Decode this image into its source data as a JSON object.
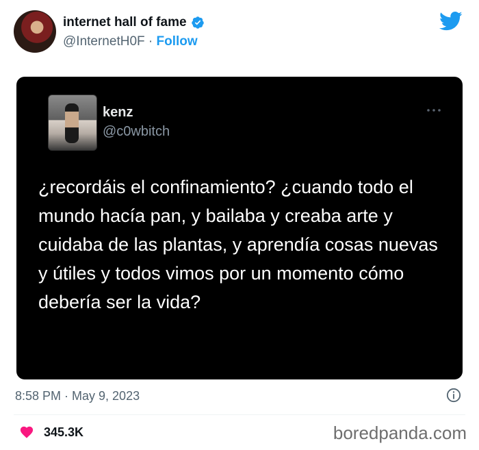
{
  "author": {
    "name": "internet hall of fame",
    "handle": "@InternetH0F",
    "separator": " · ",
    "follow_label": "Follow"
  },
  "embedded_tweet": {
    "name": "kenz",
    "handle": "@c0wbitch",
    "text": "¿recordáis el confinamiento? ¿cuando todo el mundo hacía pan, y bailaba y creaba arte y cuidaba de las plantas, y aprendía cosas nuevas y útiles y todos vimos por un momento cómo debería ser la vida?"
  },
  "meta": {
    "timestamp": "8:58 PM · May 9, 2023",
    "likes": "345.3K"
  },
  "watermark": "boredpanda.com",
  "icons": {
    "verified": "verified-badge-icon",
    "twitter": "twitter-bird-icon",
    "more": "more-dots-icon",
    "info": "info-icon",
    "heart": "heart-icon"
  },
  "colors": {
    "accent": "#1d9bf0",
    "heart": "#f91880",
    "card_bg": "#000000",
    "muted": "#536471"
  }
}
